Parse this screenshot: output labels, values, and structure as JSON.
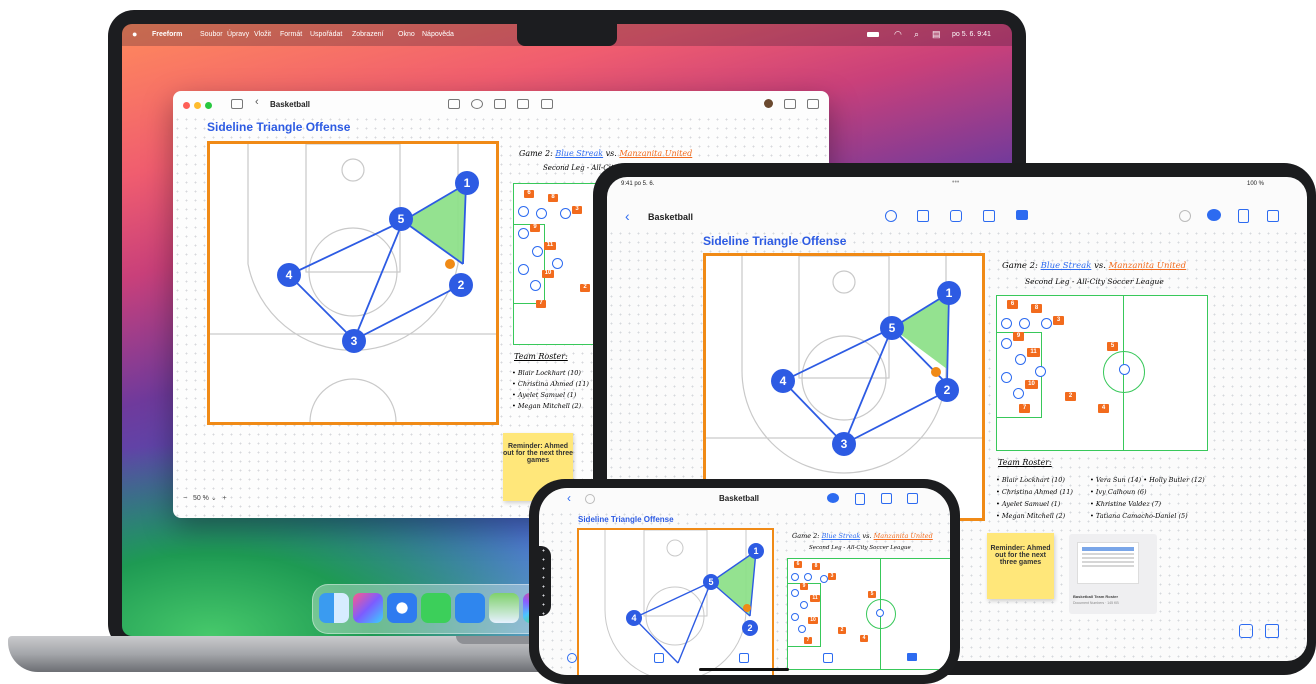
{
  "mac": {
    "menubar": {
      "app": "Freeform",
      "items": [
        "Soubor",
        "Úpravy",
        "Vložit",
        "Formát",
        "Uspořádat",
        "Zobrazení",
        "Okno",
        "Nápověda"
      ],
      "clock": "po 5. 6.  9:41"
    },
    "window": {
      "title": "Basketball",
      "zoom": "50 %",
      "zoom_minus": "−",
      "zoom_plus": "+"
    }
  },
  "ipad": {
    "status_time": "9:41  po 5. 6.",
    "status_battery": "100 %",
    "title": "Basketball"
  },
  "iphone": {
    "title": "Basketball"
  },
  "board": {
    "heading": "Sideline Triangle Offense",
    "players": [
      "1",
      "2",
      "3",
      "4",
      "5"
    ],
    "game_title": "Game 2:",
    "team_a": "Blue Streak",
    "vs": "vs.",
    "team_b": "Manzanita United",
    "subtitle": "Second Leg - All-City Soccer League",
    "roster_title": "Team Roster:",
    "roster_left": [
      "• Blair Lockhart (10)",
      "• Christina Ahmed (11)",
      "• Ayelet Samuel (1)",
      "• Megan Mitchell (2)"
    ],
    "roster_right": [
      "• Vera Sun (14)",
      "• Holly Butler (12)",
      "• Ivy Calhoun (6)",
      "• Khristine Valdez (7)",
      "• Tatiana Camacho-Daniel (5)"
    ],
    "reminder": "Reminder: Ahmed out for the next three games",
    "soccer_tags": [
      "6",
      "8",
      "3",
      "9",
      "11",
      "10",
      "5",
      "7",
      "2",
      "4"
    ],
    "doc_title": "Basketball Team Roster",
    "doc_sub": "Document Numbers · 145 KB"
  },
  "colors": {
    "court_orange": "#f08a16",
    "player_blue": "#2d5be3",
    "triangle_green": "#8ee08a",
    "field_green": "#38c85a",
    "tag_orange": "#f26b1d",
    "sticky_yellow": "#ffe77a",
    "team_a_color": "#2d6bf0",
    "team_b_color": "#f26b1d"
  },
  "icons": [
    "apple-logo-icon",
    "wifi-icon",
    "search-icon",
    "battery-icon",
    "sidebar-icon",
    "chevron-left-icon",
    "share-icon",
    "compose-icon",
    "text-box-icon",
    "shapes-icon",
    "photo-icon",
    "folder-icon",
    "undo-icon",
    "collaborate-icon",
    "sticky-note-icon",
    "pen-icon",
    "grid-icon"
  ]
}
